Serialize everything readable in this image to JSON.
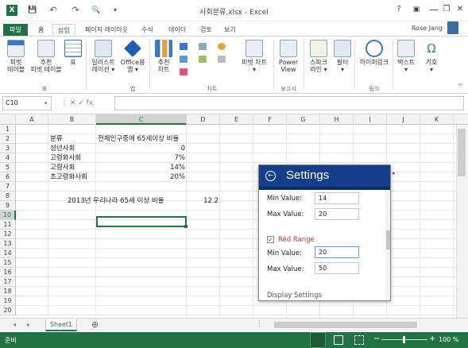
{
  "window": {
    "title": "사회분류.xlsx - Excel",
    "min": "—",
    "restore": "❐",
    "close": "✕",
    "help": "?",
    "ribbon_opts": "▣"
  },
  "qat": {
    "save": "💾",
    "undo": "↶",
    "redo": "↷",
    "preview": "🔍",
    "more": "▾"
  },
  "tabs": [
    {
      "label": "파일"
    },
    {
      "label": "홈"
    },
    {
      "label": "삽입"
    },
    {
      "label": "페이지 레이아웃"
    },
    {
      "label": "수식"
    },
    {
      "label": "데이터"
    },
    {
      "label": "검토"
    },
    {
      "label": "보기"
    }
  ],
  "user": {
    "name": "Rose Jang"
  },
  "ribbon": {
    "buttons": [
      {
        "label": "피벗\n테이블"
      },
      {
        "label": "추천\n피벗 테이블"
      },
      {
        "label": "표"
      },
      {
        "label": "일러스트\n레이션 ▾"
      },
      {
        "label": "Office용\n앱 ▾"
      },
      {
        "label": "추천\n차트"
      },
      {
        "label": "피벗 차트\n▾"
      },
      {
        "label": "Power\nView"
      },
      {
        "label": "스파크\n라인 ▾"
      },
      {
        "label": "필터\n▾"
      },
      {
        "label": "하이퍼링크"
      },
      {
        "label": "텍스트\n▾"
      },
      {
        "label": "기호\n▾"
      }
    ],
    "groups": [
      {
        "label": "표"
      },
      {
        "label": "앱"
      },
      {
        "label": "차트"
      },
      {
        "label": "보고서"
      },
      {
        "label": "링크"
      }
    ],
    "collapse": "^"
  },
  "formula_bar": {
    "cell_ref": "C10",
    "value": "",
    "icons": "⋮  ✕  ✓  fx"
  },
  "grid": {
    "columns": [
      "A",
      "B",
      "C",
      "D",
      "E",
      "F",
      "G",
      "H",
      "I",
      "J",
      "K"
    ],
    "rows": [
      "1",
      "2",
      "3",
      "4",
      "5",
      "6",
      "7",
      "8",
      "9",
      "10",
      "11",
      "12",
      "13",
      "14",
      "15",
      "16",
      "17",
      "18",
      "19",
      "20"
    ],
    "cells": {
      "b2": "분류",
      "c2": "전체인구중에 65세이상 비율",
      "b3": "성년사회",
      "c3": "0",
      "b4": "고령화사회",
      "c4": "7%",
      "b5": "고령사회",
      "c5": "14%",
      "b6": "초고령화사회",
      "c6": "20%",
      "b8": "2013년 우리나라 65세 이상 비율",
      "d8": "12.2"
    }
  },
  "panel": {
    "title": "Settings",
    "back": "←",
    "fields": [
      {
        "label": "Min Value:",
        "value": "14"
      },
      {
        "label": "Max Value:",
        "value": "20"
      },
      {
        "label": "Min Value:",
        "value": "20"
      },
      {
        "label": "Max Value:",
        "value": "50"
      }
    ],
    "checkbox_label": "Red Range",
    "checkbox_mark": "✓",
    "footer": "Display Settings",
    "collapse": "◂"
  },
  "sheets": {
    "tab": "Sheet1",
    "add": "⊕",
    "nav_prev": "◂",
    "nav_next": "▸",
    "more": "⋮"
  },
  "status": {
    "ready": "준비",
    "zoom": "100 %",
    "minus": "−",
    "plus": "+"
  },
  "colors": {
    "excel_green": "#217346",
    "panel_header": "#123e8a",
    "red_label": "#c0392b"
  },
  "icons": [
    "save-icon",
    "undo-icon",
    "redo-icon",
    "print-preview-icon",
    "pivot-table-icon",
    "table-icon",
    "app-icon",
    "chart-icon",
    "hyperlink-icon",
    "symbol-icon",
    "back-arrow-icon",
    "checkbox-icon",
    "add-sheet-icon"
  ]
}
